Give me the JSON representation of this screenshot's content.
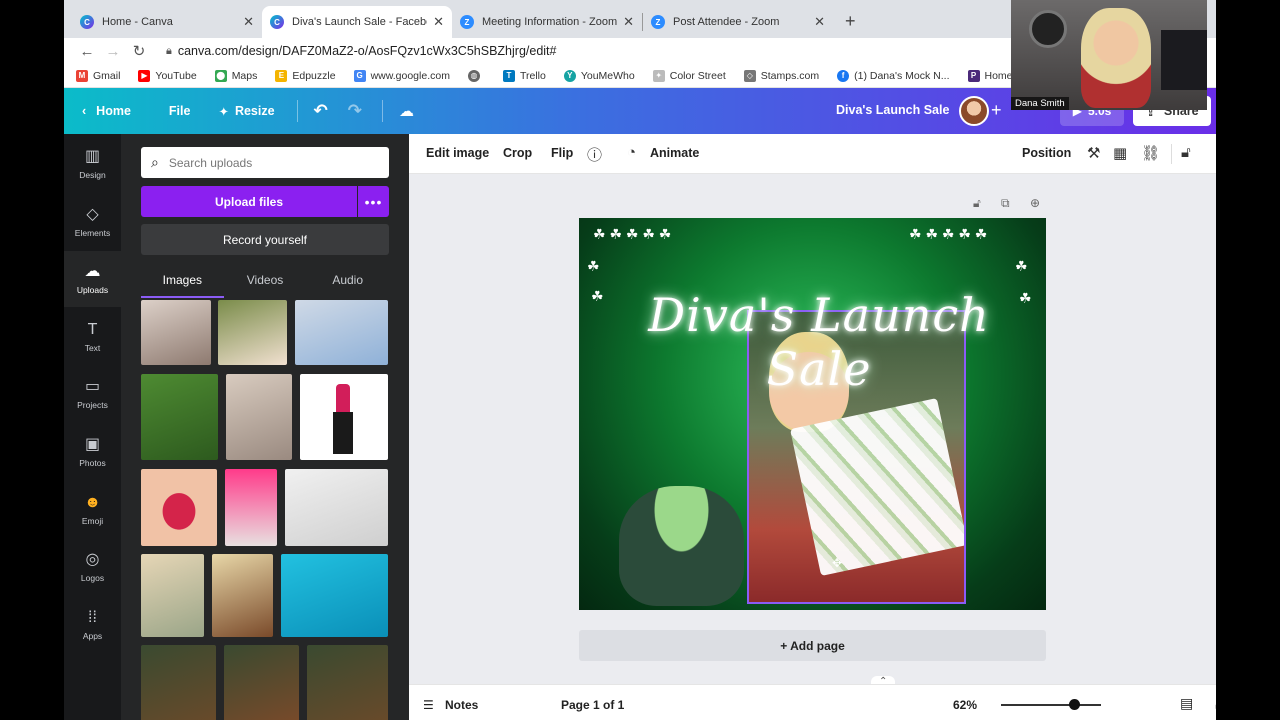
{
  "browser": {
    "tabs": [
      {
        "title": "Home - Canva",
        "icon": "canva"
      },
      {
        "title": "Diva's Launch Sale - Facebook",
        "icon": "canva"
      },
      {
        "title": "Meeting Information - Zoom",
        "icon": "zoom"
      },
      {
        "title": "Post Attendee - Zoom",
        "icon": "zoom"
      }
    ],
    "url": "canva.com/design/DAFZ0MaZ2-o/AosFQzv1cWx3C5hSBZhjrg/edit#",
    "bookmarks": [
      "Gmail",
      "YouTube",
      "Maps",
      "Edpuzzle",
      "www.google.com",
      "Trello",
      "YouMeWho",
      "Color Street",
      "Stamps.com",
      "(1) Dana's Mock N...",
      "Home | Prestige P..."
    ]
  },
  "header": {
    "home": "Home",
    "file": "File",
    "resize": "Resize",
    "title": "Diva's Launch Sale",
    "play": "5.0s",
    "share": "Share",
    "gradient": [
      "#0bbcc9",
      "#6a2ee8"
    ]
  },
  "rail": [
    {
      "label": "Design",
      "icon": "design-icon"
    },
    {
      "label": "Elements",
      "icon": "elements-icon"
    },
    {
      "label": "Uploads",
      "icon": "upload-cloud-icon"
    },
    {
      "label": "Text",
      "icon": "text-icon"
    },
    {
      "label": "Projects",
      "icon": "folder-icon"
    },
    {
      "label": "Photos",
      "icon": "photo-icon"
    },
    {
      "label": "Emoji",
      "icon": "emoji-icon"
    },
    {
      "label": "Logos",
      "icon": "logo-icon"
    },
    {
      "label": "Apps",
      "icon": "apps-icon"
    }
  ],
  "panel": {
    "search_placeholder": "Search uploads",
    "upload_label": "Upload files",
    "record_label": "Record yourself",
    "tabs": [
      "Images",
      "Videos",
      "Audio"
    ],
    "accent": "#8b20f0"
  },
  "toolbar": {
    "edit_image": "Edit image",
    "crop": "Crop",
    "flip": "Flip",
    "animate": "Animate",
    "position": "Position"
  },
  "canvas": {
    "headline": "Diva's Launch Sale",
    "add_page": "+ Add page"
  },
  "footer": {
    "notes": "Notes",
    "page": "Page 1 of 1",
    "zoom": "62%",
    "zoom_fraction": 0.73
  },
  "webcam": {
    "name": "Dana Smith"
  }
}
